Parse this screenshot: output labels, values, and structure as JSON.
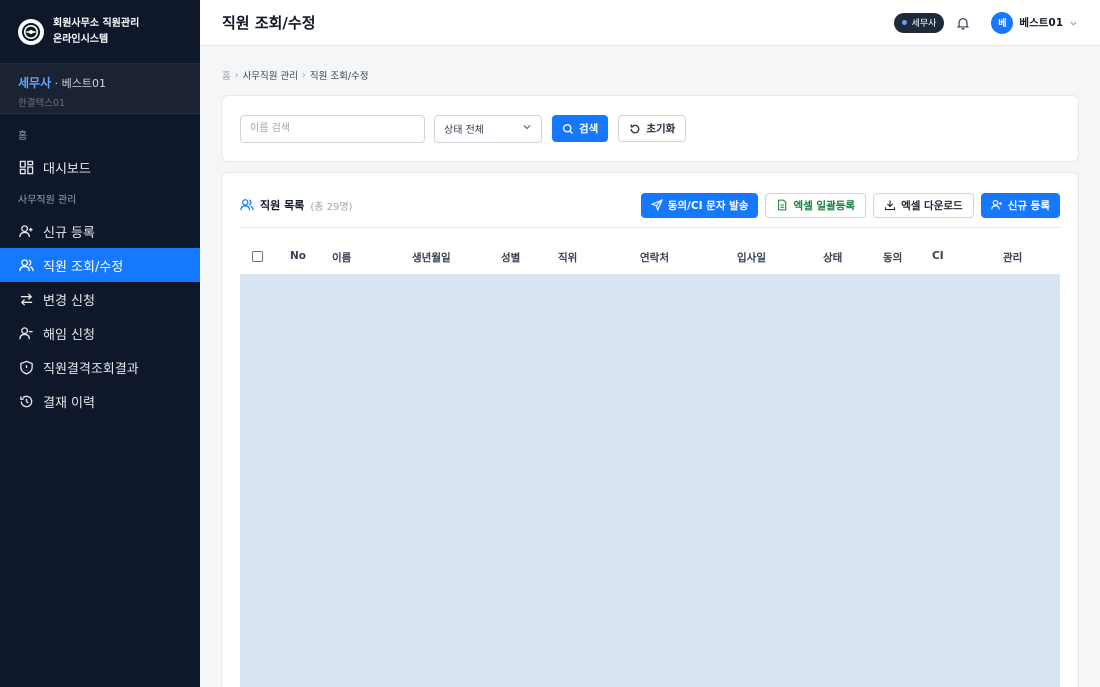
{
  "app": {
    "brand_line1": "회원사무소 직원관리",
    "brand_line2": "온라인시스템"
  },
  "user": {
    "role": "세무사",
    "separator": "·",
    "name": "베스트01",
    "office": "한결택스01"
  },
  "sidebar": {
    "section_home": "홈",
    "dashboard": "대시보드",
    "section_staff": "사무직원 관리",
    "items": [
      {
        "label": "신규 등록",
        "icon": "user-plus-icon"
      },
      {
        "label": "직원 조회/수정",
        "icon": "users-icon",
        "active": true
      },
      {
        "label": "변경 신청",
        "icon": "swap-icon"
      },
      {
        "label": "해임 신청",
        "icon": "user-minus-icon"
      },
      {
        "label": "직원결격조회결과",
        "icon": "shield-icon"
      },
      {
        "label": "결재 이력",
        "icon": "history-icon"
      }
    ]
  },
  "header": {
    "title": "직원 조회/수정",
    "role_badge": "세무사",
    "avatar_initial": "베",
    "profile_name": "베스트01"
  },
  "breadcrumb": {
    "home": "홈",
    "section": "사무직원 관리",
    "current": "직원 조회/수정"
  },
  "search": {
    "placeholder": "이름 검색",
    "status_value": "상태 전체",
    "search_label": "검색",
    "reset_label": "초기화"
  },
  "list": {
    "title": "직원 목록",
    "count": "(총 29명)",
    "actions": {
      "consent": "동의/CI 문자 발송",
      "excel_upload": "엑셀 일괄등록",
      "excel_download": "엑셀 다운로드",
      "new": "신규 등록"
    },
    "columns": [
      "No",
      "이름",
      "생년월일",
      "성별",
      "직위",
      "연락처",
      "입사일",
      "상태",
      "동의",
      "CI",
      "관리"
    ]
  },
  "colors": {
    "sidebar_bg": "#0f172a",
    "accent": "#1677ff",
    "table_placeholder": "#d9e4f2"
  }
}
